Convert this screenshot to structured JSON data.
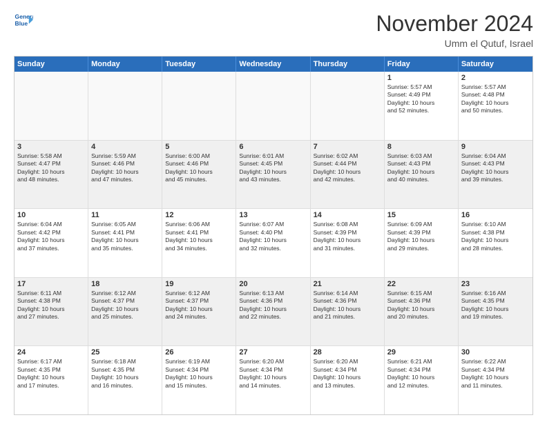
{
  "logo": {
    "line1": "General",
    "line2": "Blue"
  },
  "title": "November 2024",
  "location": "Umm el Qutuf, Israel",
  "header_days": [
    "Sunday",
    "Monday",
    "Tuesday",
    "Wednesday",
    "Thursday",
    "Friday",
    "Saturday"
  ],
  "rows": [
    {
      "alt": false,
      "cells": [
        {
          "day": "",
          "empty": true,
          "text": ""
        },
        {
          "day": "",
          "empty": true,
          "text": ""
        },
        {
          "day": "",
          "empty": true,
          "text": ""
        },
        {
          "day": "",
          "empty": true,
          "text": ""
        },
        {
          "day": "",
          "empty": true,
          "text": ""
        },
        {
          "day": "1",
          "empty": false,
          "text": "Sunrise: 5:57 AM\nSunset: 4:49 PM\nDaylight: 10 hours\nand 52 minutes."
        },
        {
          "day": "2",
          "empty": false,
          "text": "Sunrise: 5:57 AM\nSunset: 4:48 PM\nDaylight: 10 hours\nand 50 minutes."
        }
      ]
    },
    {
      "alt": true,
      "cells": [
        {
          "day": "3",
          "empty": false,
          "text": "Sunrise: 5:58 AM\nSunset: 4:47 PM\nDaylight: 10 hours\nand 48 minutes."
        },
        {
          "day": "4",
          "empty": false,
          "text": "Sunrise: 5:59 AM\nSunset: 4:46 PM\nDaylight: 10 hours\nand 47 minutes."
        },
        {
          "day": "5",
          "empty": false,
          "text": "Sunrise: 6:00 AM\nSunset: 4:46 PM\nDaylight: 10 hours\nand 45 minutes."
        },
        {
          "day": "6",
          "empty": false,
          "text": "Sunrise: 6:01 AM\nSunset: 4:45 PM\nDaylight: 10 hours\nand 43 minutes."
        },
        {
          "day": "7",
          "empty": false,
          "text": "Sunrise: 6:02 AM\nSunset: 4:44 PM\nDaylight: 10 hours\nand 42 minutes."
        },
        {
          "day": "8",
          "empty": false,
          "text": "Sunrise: 6:03 AM\nSunset: 4:43 PM\nDaylight: 10 hours\nand 40 minutes."
        },
        {
          "day": "9",
          "empty": false,
          "text": "Sunrise: 6:04 AM\nSunset: 4:43 PM\nDaylight: 10 hours\nand 39 minutes."
        }
      ]
    },
    {
      "alt": false,
      "cells": [
        {
          "day": "10",
          "empty": false,
          "text": "Sunrise: 6:04 AM\nSunset: 4:42 PM\nDaylight: 10 hours\nand 37 minutes."
        },
        {
          "day": "11",
          "empty": false,
          "text": "Sunrise: 6:05 AM\nSunset: 4:41 PM\nDaylight: 10 hours\nand 35 minutes."
        },
        {
          "day": "12",
          "empty": false,
          "text": "Sunrise: 6:06 AM\nSunset: 4:41 PM\nDaylight: 10 hours\nand 34 minutes."
        },
        {
          "day": "13",
          "empty": false,
          "text": "Sunrise: 6:07 AM\nSunset: 4:40 PM\nDaylight: 10 hours\nand 32 minutes."
        },
        {
          "day": "14",
          "empty": false,
          "text": "Sunrise: 6:08 AM\nSunset: 4:39 PM\nDaylight: 10 hours\nand 31 minutes."
        },
        {
          "day": "15",
          "empty": false,
          "text": "Sunrise: 6:09 AM\nSunset: 4:39 PM\nDaylight: 10 hours\nand 29 minutes."
        },
        {
          "day": "16",
          "empty": false,
          "text": "Sunrise: 6:10 AM\nSunset: 4:38 PM\nDaylight: 10 hours\nand 28 minutes."
        }
      ]
    },
    {
      "alt": true,
      "cells": [
        {
          "day": "17",
          "empty": false,
          "text": "Sunrise: 6:11 AM\nSunset: 4:38 PM\nDaylight: 10 hours\nand 27 minutes."
        },
        {
          "day": "18",
          "empty": false,
          "text": "Sunrise: 6:12 AM\nSunset: 4:37 PM\nDaylight: 10 hours\nand 25 minutes."
        },
        {
          "day": "19",
          "empty": false,
          "text": "Sunrise: 6:12 AM\nSunset: 4:37 PM\nDaylight: 10 hours\nand 24 minutes."
        },
        {
          "day": "20",
          "empty": false,
          "text": "Sunrise: 6:13 AM\nSunset: 4:36 PM\nDaylight: 10 hours\nand 22 minutes."
        },
        {
          "day": "21",
          "empty": false,
          "text": "Sunrise: 6:14 AM\nSunset: 4:36 PM\nDaylight: 10 hours\nand 21 minutes."
        },
        {
          "day": "22",
          "empty": false,
          "text": "Sunrise: 6:15 AM\nSunset: 4:36 PM\nDaylight: 10 hours\nand 20 minutes."
        },
        {
          "day": "23",
          "empty": false,
          "text": "Sunrise: 6:16 AM\nSunset: 4:35 PM\nDaylight: 10 hours\nand 19 minutes."
        }
      ]
    },
    {
      "alt": false,
      "cells": [
        {
          "day": "24",
          "empty": false,
          "text": "Sunrise: 6:17 AM\nSunset: 4:35 PM\nDaylight: 10 hours\nand 17 minutes."
        },
        {
          "day": "25",
          "empty": false,
          "text": "Sunrise: 6:18 AM\nSunset: 4:35 PM\nDaylight: 10 hours\nand 16 minutes."
        },
        {
          "day": "26",
          "empty": false,
          "text": "Sunrise: 6:19 AM\nSunset: 4:34 PM\nDaylight: 10 hours\nand 15 minutes."
        },
        {
          "day": "27",
          "empty": false,
          "text": "Sunrise: 6:20 AM\nSunset: 4:34 PM\nDaylight: 10 hours\nand 14 minutes."
        },
        {
          "day": "28",
          "empty": false,
          "text": "Sunrise: 6:20 AM\nSunset: 4:34 PM\nDaylight: 10 hours\nand 13 minutes."
        },
        {
          "day": "29",
          "empty": false,
          "text": "Sunrise: 6:21 AM\nSunset: 4:34 PM\nDaylight: 10 hours\nand 12 minutes."
        },
        {
          "day": "30",
          "empty": false,
          "text": "Sunrise: 6:22 AM\nSunset: 4:34 PM\nDaylight: 10 hours\nand 11 minutes."
        }
      ]
    }
  ]
}
